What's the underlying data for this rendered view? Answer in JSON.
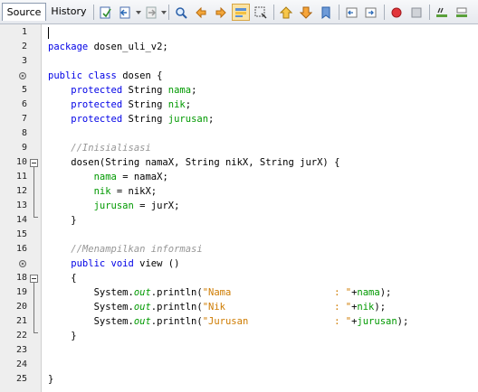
{
  "toolbar": {
    "tabs": [
      {
        "label": "Source",
        "active": true
      },
      {
        "label": "History",
        "active": false
      }
    ],
    "icons": [
      "last-edit-icon",
      "back-icon",
      "forward-icon",
      "find-icon",
      "find-previous-icon",
      "find-next-icon",
      "toggle-highlight-icon",
      "toggle-rect-selection-icon",
      "previous-bookmark-icon",
      "next-bookmark-icon",
      "toggle-bookmark-icon",
      "shift-left-icon",
      "shift-right-icon",
      "start-macro-icon",
      "stop-macro-icon",
      "comment-icon",
      "uncomment-icon"
    ]
  },
  "editor": {
    "line_numbers": [
      "1",
      "2",
      "3",
      "4",
      "5",
      "6",
      "7",
      "8",
      "9",
      "10",
      "11",
      "12",
      "13",
      "14",
      "15",
      "16",
      "17",
      "18",
      "19",
      "20",
      "21",
      "22",
      "23",
      "24",
      "25"
    ],
    "lines": [
      [],
      [
        {
          "t": "package ",
          "k": "kw"
        },
        {
          "t": "dosen_uli_v2;",
          "k": "plain"
        }
      ],
      [],
      [
        {
          "t": "public class ",
          "k": "kw"
        },
        {
          "t": "dosen {",
          "k": "plain"
        }
      ],
      [
        {
          "t": "    protected ",
          "k": "kw"
        },
        {
          "t": "String ",
          "k": "plain"
        },
        {
          "t": "nama",
          "k": "field"
        },
        {
          "t": ";",
          "k": "plain"
        }
      ],
      [
        {
          "t": "    protected ",
          "k": "kw"
        },
        {
          "t": "String ",
          "k": "plain"
        },
        {
          "t": "nik",
          "k": "field"
        },
        {
          "t": ";",
          "k": "plain"
        }
      ],
      [
        {
          "t": "    protected ",
          "k": "kw"
        },
        {
          "t": "String ",
          "k": "plain"
        },
        {
          "t": "jurusan",
          "k": "field"
        },
        {
          "t": ";",
          "k": "plain"
        }
      ],
      [],
      [
        {
          "t": "    //Inisialisasi",
          "k": "cm"
        }
      ],
      [
        {
          "t": "    dosen(String namaX, String nikX, String jurX) {",
          "k": "plain"
        }
      ],
      [
        {
          "t": "        ",
          "k": "plain"
        },
        {
          "t": "nama",
          "k": "field"
        },
        {
          "t": " = namaX;",
          "k": "plain"
        }
      ],
      [
        {
          "t": "        ",
          "k": "plain"
        },
        {
          "t": "nik",
          "k": "field"
        },
        {
          "t": " = nikX;",
          "k": "plain"
        }
      ],
      [
        {
          "t": "        ",
          "k": "plain"
        },
        {
          "t": "jurusan",
          "k": "field"
        },
        {
          "t": " = jurX;",
          "k": "plain"
        }
      ],
      [
        {
          "t": "    }",
          "k": "plain"
        }
      ],
      [],
      [
        {
          "t": "    //Menampilkan informasi",
          "k": "cm"
        }
      ],
      [
        {
          "t": "    public void ",
          "k": "kw"
        },
        {
          "t": "view ()",
          "k": "plain"
        }
      ],
      [
        {
          "t": "    {",
          "k": "plain"
        }
      ],
      [
        {
          "t": "        System.",
          "k": "plain"
        },
        {
          "t": "out",
          "k": "static"
        },
        {
          "t": ".println(",
          "k": "plain"
        },
        {
          "t": "\"Nama                  : \"",
          "k": "str"
        },
        {
          "t": "+",
          "k": "plain"
        },
        {
          "t": "nama",
          "k": "field"
        },
        {
          "t": ");",
          "k": "plain"
        }
      ],
      [
        {
          "t": "        System.",
          "k": "plain"
        },
        {
          "t": "out",
          "k": "static"
        },
        {
          "t": ".println(",
          "k": "plain"
        },
        {
          "t": "\"Nik                   : \"",
          "k": "str"
        },
        {
          "t": "+",
          "k": "plain"
        },
        {
          "t": "nik",
          "k": "field"
        },
        {
          "t": ");",
          "k": "plain"
        }
      ],
      [
        {
          "t": "        System.",
          "k": "plain"
        },
        {
          "t": "out",
          "k": "static"
        },
        {
          "t": ".println(",
          "k": "plain"
        },
        {
          "t": "\"Jurusan               : \"",
          "k": "str"
        },
        {
          "t": "+",
          "k": "plain"
        },
        {
          "t": "jurusan",
          "k": "field"
        },
        {
          "t": ");",
          "k": "plain"
        }
      ],
      [
        {
          "t": "    }",
          "k": "plain"
        }
      ],
      [],
      [],
      [
        {
          "t": "}",
          "k": "plain"
        }
      ]
    ],
    "markers": {
      "override_lines": [
        "3",
        "16"
      ],
      "fold_lines": [
        "10",
        "18"
      ]
    },
    "colors": {
      "keyword": "#0000e6",
      "field": "#009900",
      "string": "#ce7b00",
      "comment": "#969696"
    }
  }
}
